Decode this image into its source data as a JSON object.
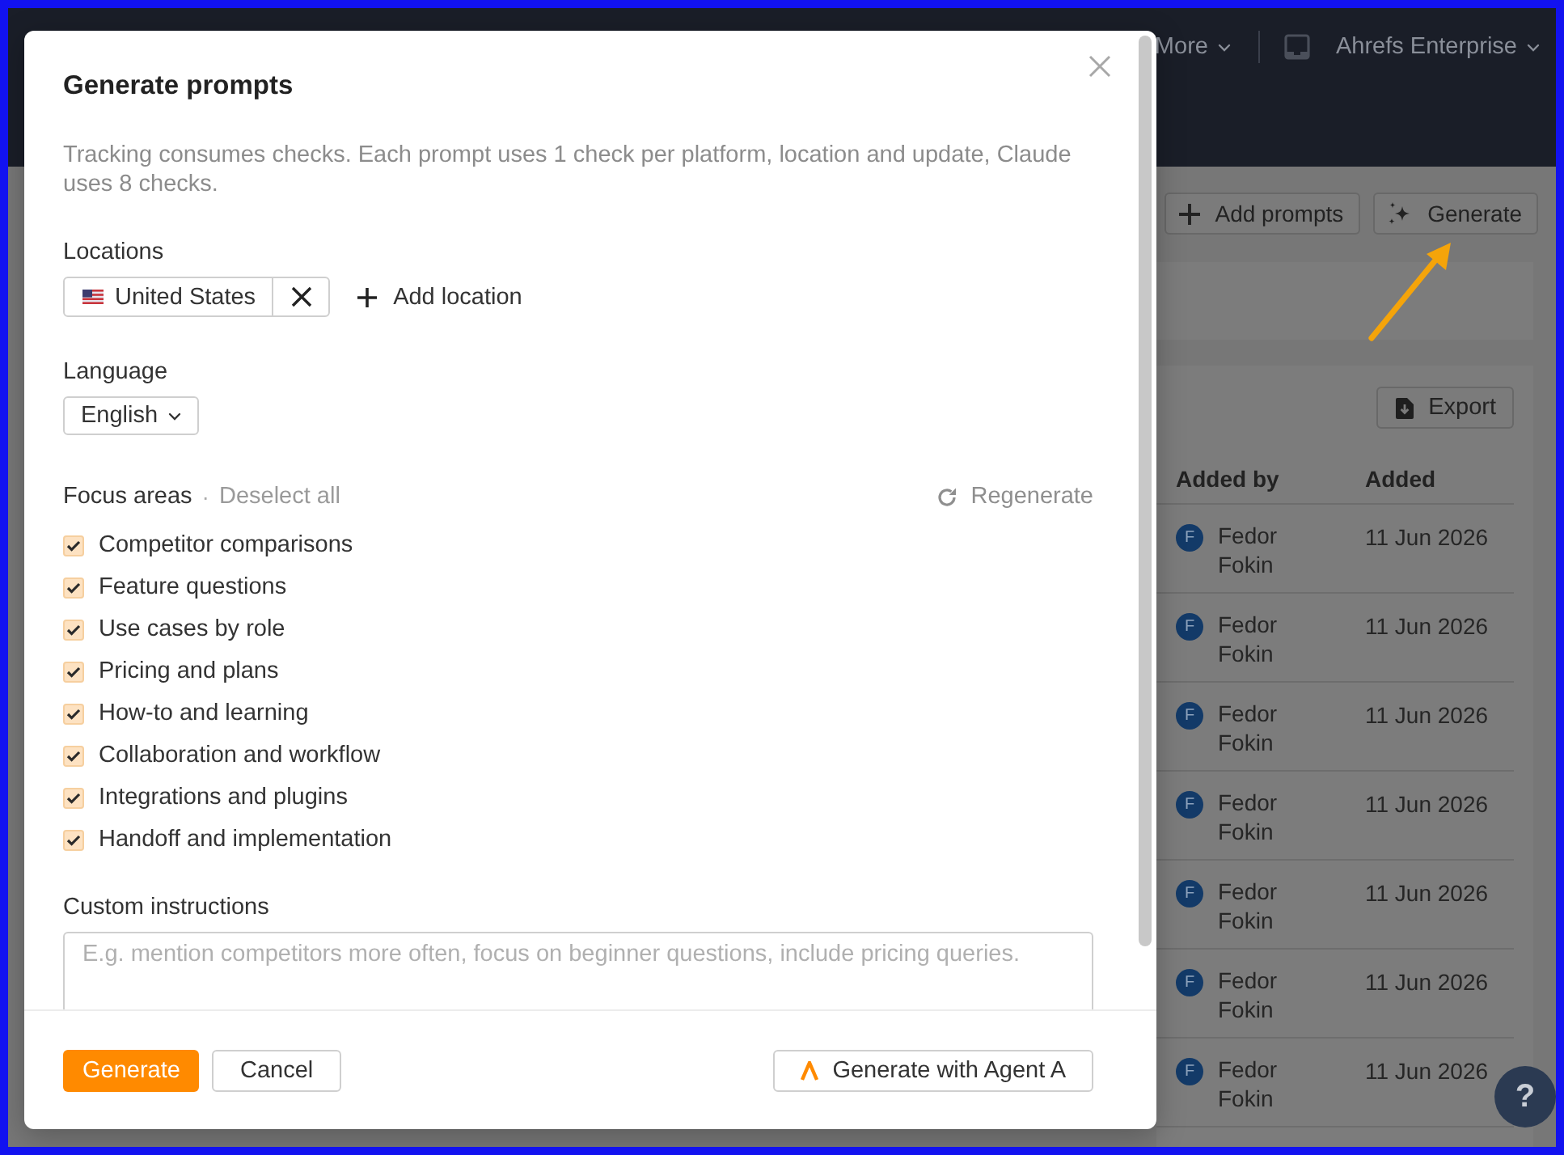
{
  "top_bar": {
    "menus": [
      {
        "label": "More"
      },
      {
        "label": "Ahrefs Enterprise"
      }
    ]
  },
  "toolbar": {
    "buttons": [
      {
        "kind": "add",
        "label": "Add prompts"
      },
      {
        "kind": "generate",
        "label": "Generate"
      }
    ]
  },
  "table": {
    "export_label": "Export",
    "columns": [
      "Added by",
      "Added"
    ],
    "rows": [
      {
        "avatar": "F",
        "added_by": "Fedor Fokin",
        "added": "11 Jun 2026"
      },
      {
        "avatar": "F",
        "added_by": "Fedor Fokin",
        "added": "11 Jun 2026"
      },
      {
        "avatar": "F",
        "added_by": "Fedor Fokin",
        "added": "11 Jun 2026"
      },
      {
        "avatar": "F",
        "added_by": "Fedor Fokin",
        "added": "11 Jun 2026"
      },
      {
        "avatar": "F",
        "added_by": "Fedor Fokin",
        "added": "11 Jun 2026"
      },
      {
        "avatar": "F",
        "added_by": "Fedor Fokin",
        "added": "11 Jun 2026"
      },
      {
        "avatar": "F",
        "added_by": "Fedor Fokin",
        "added": "11 Jun 2026"
      }
    ]
  },
  "help_button": "?",
  "dialog": {
    "title": "Generate prompts",
    "description": "Tracking consumes checks. Each prompt uses 1 check per platform, location and update, Claude uses 8 checks.",
    "locations": {
      "label": "Locations",
      "items": [
        {
          "name": "United States"
        }
      ],
      "add_label": "Add location"
    },
    "language": {
      "label": "Language",
      "value": "English"
    },
    "focus_areas": {
      "label": "Focus areas",
      "separator": "·",
      "deselect_label": "Deselect all",
      "regenerate_label": "Regenerate",
      "items": [
        {
          "label": "Competitor comparisons",
          "checked": true
        },
        {
          "label": "Feature questions",
          "checked": true
        },
        {
          "label": "Use cases by role",
          "checked": true
        },
        {
          "label": "Pricing and plans",
          "checked": true
        },
        {
          "label": "How-to and learning",
          "checked": true
        },
        {
          "label": "Collaboration and workflow",
          "checked": true
        },
        {
          "label": "Integrations and plugins",
          "checked": true
        },
        {
          "label": "Handoff and implementation",
          "checked": true
        }
      ]
    },
    "custom_instructions": {
      "label": "Custom instructions",
      "placeholder": "E.g. mention competitors more often, focus on beginner questions, include pricing queries."
    },
    "footer": {
      "primary_label": "Generate",
      "cancel_label": "Cancel",
      "agent_label": "Generate with Agent A"
    }
  }
}
